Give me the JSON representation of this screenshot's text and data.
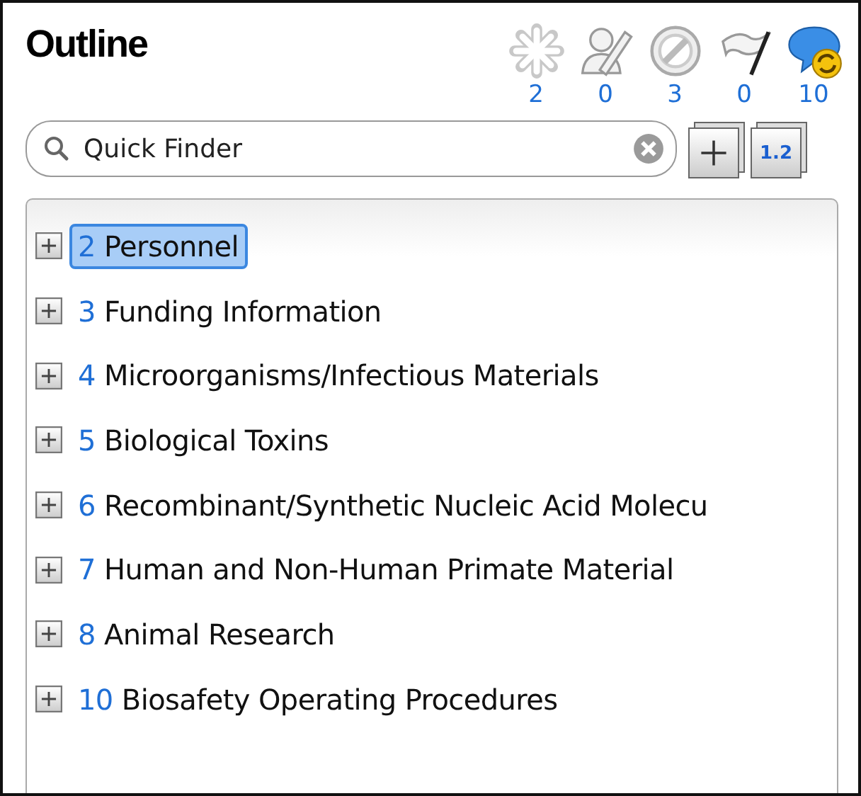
{
  "title": "Outline",
  "filters": [
    {
      "kind": "asterisk",
      "count": "2"
    },
    {
      "kind": "person",
      "count": "0"
    },
    {
      "kind": "blocked",
      "count": "3"
    },
    {
      "kind": "flag",
      "count": "0"
    },
    {
      "kind": "chat",
      "count": "10"
    }
  ],
  "search": {
    "placeholder": "Quick Finder"
  },
  "toolbar": {
    "numbering_label": "1.2"
  },
  "tree": [
    {
      "number": "2",
      "label": "Personnel",
      "selected": true,
      "expanded": false
    },
    {
      "number": "3",
      "label": "Funding Information",
      "selected": false,
      "expanded": false
    },
    {
      "number": "4",
      "label": "Microorganisms/Infectious Materials",
      "selected": false,
      "expanded": false
    },
    {
      "number": "5",
      "label": "Biological Toxins",
      "selected": false,
      "expanded": false
    },
    {
      "number": "6",
      "label": "Recombinant/Synthetic Nucleic Acid Molecu",
      "selected": false,
      "expanded": false
    },
    {
      "number": "7",
      "label": "Human and Non-Human Primate Material",
      "selected": false,
      "expanded": false
    },
    {
      "number": "8",
      "label": "Animal Research",
      "selected": false,
      "expanded": false
    },
    {
      "number": "10",
      "label": "Biosafety Operating Procedures",
      "selected": false,
      "expanded": false
    }
  ]
}
